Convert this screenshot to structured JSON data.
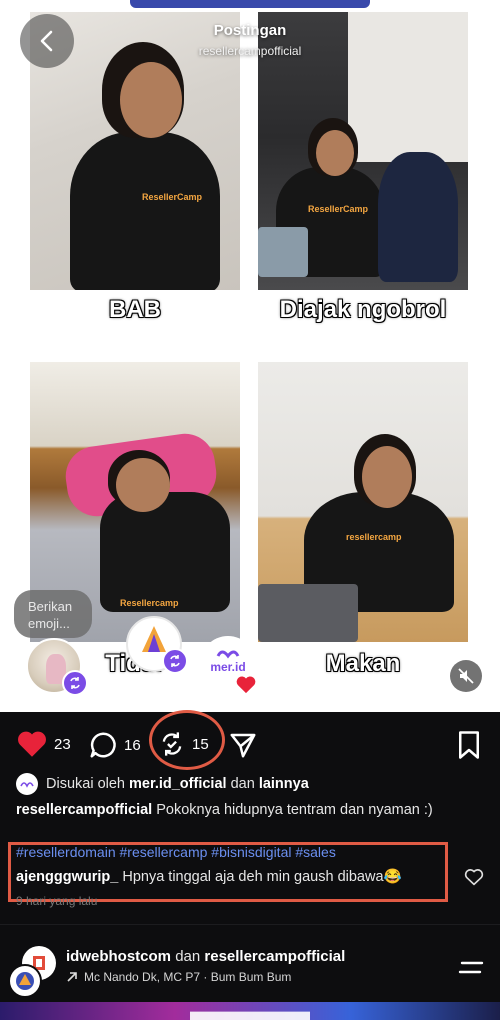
{
  "header": {
    "title": "Postingan",
    "username": "resellercampofficial"
  },
  "photos": [
    {
      "caption": "BAB",
      "shirt_brand": "ResellerCamp"
    },
    {
      "caption": "Diajak ngobrol",
      "shirt_brand": "ResellerCamp"
    },
    {
      "caption": "Tidur",
      "shirt_brand": "Resellercamp"
    },
    {
      "caption": "Makan",
      "shirt_brand": "resellercamp"
    }
  ],
  "emoji_prompt": "Berikan emoji...",
  "collab_logo": "mer.id",
  "actions": {
    "likes": "23",
    "comments": "16",
    "reposts": "15"
  },
  "liked_by": {
    "prefix": "Disukai oleh",
    "user": "mer.id_official",
    "mid": "dan",
    "others": "lainnya"
  },
  "post": {
    "author": "resellercampofficial",
    "text": "Pokoknya hidupnya tentram dan nyaman :)"
  },
  "comment": {
    "hashtags": "#resellerdomain #resellercamp #bisnisdigital #sales",
    "author": "ajengggwurip_",
    "text": "Hpnya tinggal aja deh min gaush dibawa😂",
    "time": "9 hari yang lalu"
  },
  "next_post": {
    "user1": "idwebhostcom",
    "joiner": "dan",
    "user2": "resellercampofficial",
    "music": "Mc Nando Dk, MC P7 · Bum Bum Bum"
  },
  "colors": {
    "highlight": "#e05b45",
    "like": "#e8233a",
    "hashtag": "#6b8ff0",
    "repost_badge": "#7b4ce6"
  }
}
